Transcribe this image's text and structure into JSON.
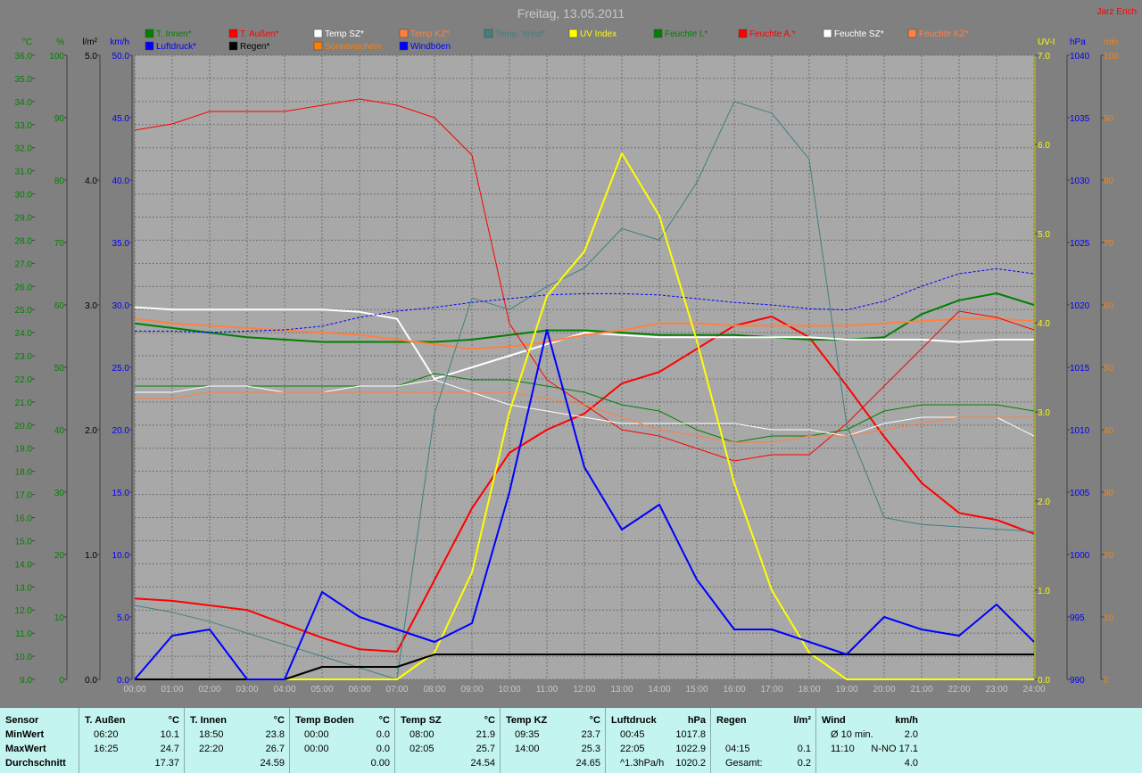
{
  "title": "Freitag, 13.05.2011",
  "author": "Jarz Erich",
  "legend_row1": [
    {
      "label": "T. Innen*",
      "color": "#008000"
    },
    {
      "label": "T. Außen*",
      "color": "#ff0000"
    },
    {
      "label": "Temp SZ*",
      "color": "#ffffff"
    },
    {
      "label": "Temp KZ*",
      "color": "#ff8040"
    },
    {
      "label": "Temp. Wind*",
      "color": "#408080"
    },
    {
      "label": "UV Index",
      "color": "#ffff00"
    },
    {
      "label": "Feuchte I.*",
      "color": "#008000"
    },
    {
      "label": "Feuchte A.*",
      "color": "#ff0000"
    },
    {
      "label": "Feuchte SZ*",
      "color": "#ffffff"
    },
    {
      "label": "Feuchte KZ*",
      "color": "#ff8040"
    }
  ],
  "legend_row2": [
    {
      "label": "Luftdruck*",
      "color": "#0000ff"
    },
    {
      "label": "Regen*",
      "color": "#000000"
    },
    {
      "label": "Sonnenschein",
      "color": "#ff8000"
    },
    {
      "label": "Windböen",
      "color": "#0000ff"
    }
  ],
  "axes": {
    "celsius": {
      "unit": "°C",
      "color": "#008000",
      "min": 9,
      "max": 36,
      "ticks": [
        "36.0",
        "35.0",
        "34.0",
        "33.0",
        "32.0",
        "31.0",
        "30.0",
        "29.0",
        "28.0",
        "27.0",
        "26.0",
        "25.0",
        "24.0",
        "23.0",
        "22.0",
        "21.0",
        "20.0",
        "19.0",
        "18.0",
        "17.0",
        "16.0",
        "15.0",
        "14.0",
        "13.0",
        "12.0",
        "11.0",
        "10.0",
        "9.0"
      ]
    },
    "percent": {
      "unit": "%",
      "color": "#008000",
      "ticks": [
        "100",
        "90",
        "80",
        "70",
        "60",
        "50",
        "40",
        "30",
        "20",
        "10",
        "0"
      ]
    },
    "rain": {
      "unit": "l/m²",
      "color": "#000000",
      "ticks": [
        "5.0",
        "4.0",
        "3.0",
        "2.0",
        "1.0",
        "0.0"
      ]
    },
    "kmh": {
      "unit": "km/h",
      "color": "#0000ff",
      "ticks": [
        "50.0",
        "45.0",
        "40.0",
        "35.0",
        "30.0",
        "25.0",
        "20.0",
        "15.0",
        "10.0",
        "5.0",
        "0.0"
      ]
    },
    "uv": {
      "unit": "UV-I",
      "color": "#ffff00",
      "ticks": [
        "7.0",
        "6.0",
        "5.0",
        "4.0",
        "3.0",
        "2.0",
        "1.0",
        "0.0"
      ]
    },
    "hpa": {
      "unit": "hPa",
      "color": "#0000ff",
      "ticks": [
        "1040",
        "1035",
        "1030",
        "1025",
        "1020",
        "1015",
        "1010",
        "1005",
        "1000",
        "995",
        "990"
      ]
    },
    "min": {
      "unit": "min",
      "color": "#ff8000",
      "ticks": [
        "100",
        "90",
        "80",
        "70",
        "60",
        "50",
        "40",
        "30",
        "20",
        "10",
        "0"
      ]
    }
  },
  "chart_data": {
    "type": "line",
    "title": "Freitag, 13.05.2011",
    "x": [
      "00:00",
      "01:00",
      "02:00",
      "03:00",
      "04:00",
      "05:00",
      "06:00",
      "07:00",
      "08:00",
      "09:00",
      "10:00",
      "11:00",
      "12:00",
      "13:00",
      "14:00",
      "15:00",
      "16:00",
      "17:00",
      "18:00",
      "19:00",
      "20:00",
      "21:00",
      "22:00",
      "23:00",
      "24:00"
    ],
    "grid": true,
    "series": [
      {
        "name": "T. Außen*",
        "axis": "celsius",
        "color": "#ff0000",
        "width": 2,
        "values": [
          12.5,
          12.4,
          12.2,
          12.0,
          11.4,
          10.8,
          10.3,
          10.2,
          13.3,
          16.4,
          18.8,
          19.8,
          20.5,
          21.8,
          22.3,
          23.3,
          24.3,
          24.7,
          23.8,
          21.7,
          19.5,
          17.5,
          16.2,
          15.9,
          15.3
        ]
      },
      {
        "name": "T. Innen*",
        "axis": "celsius",
        "color": "#008000",
        "width": 2,
        "values": [
          24.4,
          24.2,
          24.0,
          23.8,
          23.7,
          23.6,
          23.6,
          23.6,
          23.6,
          23.7,
          23.9,
          24.1,
          24.1,
          24.0,
          23.9,
          23.9,
          23.9,
          23.8,
          23.7,
          23.7,
          23.8,
          24.8,
          25.4,
          25.7,
          25.2
        ]
      },
      {
        "name": "Temp SZ*",
        "axis": "celsius",
        "color": "#ffffff",
        "width": 2,
        "values": [
          25.1,
          25.0,
          25.0,
          25.0,
          25.0,
          25.0,
          24.9,
          24.6,
          22.0,
          22.5,
          23.0,
          23.5,
          24.0,
          23.9,
          23.8,
          23.8,
          23.8,
          23.8,
          23.8,
          23.7,
          23.7,
          23.7,
          23.6,
          23.7,
          23.7
        ]
      },
      {
        "name": "Temp KZ*",
        "axis": "celsius",
        "color": "#ff8040",
        "width": 2,
        "values": [
          24.6,
          24.4,
          24.3,
          24.2,
          24.1,
          24.0,
          23.9,
          23.7,
          23.5,
          23.3,
          23.4,
          23.6,
          23.9,
          24.1,
          24.4,
          24.4,
          24.3,
          24.3,
          24.3,
          24.3,
          24.4,
          24.5,
          24.6,
          24.6,
          24.5
        ]
      },
      {
        "name": "Feuchte I.*",
        "axis": "percent",
        "color": "#008000",
        "width": 1,
        "values": [
          47,
          47,
          47,
          47,
          47,
          47,
          47,
          47,
          49,
          48,
          48,
          47,
          46,
          44,
          43,
          40,
          38,
          39,
          39,
          40,
          43,
          44,
          44,
          44,
          43
        ]
      },
      {
        "name": "Feuchte A.*",
        "axis": "percent",
        "color": "#ff0000",
        "width": 1,
        "values": [
          88,
          89,
          91,
          91,
          91,
          92,
          93,
          92,
          90,
          84,
          57,
          48,
          44,
          40,
          39,
          37,
          35,
          36,
          36,
          41,
          47,
          53,
          59,
          58,
          56
        ]
      },
      {
        "name": "Feuchte SZ*",
        "axis": "percent",
        "color": "#ffffff",
        "width": 1,
        "values": [
          46,
          46,
          47,
          47,
          46,
          46,
          47,
          47,
          48,
          46,
          44,
          43,
          42,
          41,
          41,
          41,
          41,
          40,
          40,
          39,
          41,
          42,
          42,
          42,
          39
        ]
      },
      {
        "name": "Feuchte KZ*",
        "axis": "percent",
        "color": "#ff8040",
        "width": 1,
        "values": [
          45,
          45,
          46,
          46,
          46,
          46,
          46,
          46,
          46,
          46,
          46,
          45,
          44,
          42,
          40,
          39,
          38,
          38,
          39,
          39,
          40,
          41,
          42,
          42,
          42
        ]
      },
      {
        "name": "Temp. Wind*",
        "axis": "celsius",
        "color": "#408080",
        "width": 1,
        "values": [
          12.2,
          11.9,
          11.5,
          11.0,
          10.5,
          10.0,
          9.5,
          9.0,
          20.5,
          25.5,
          25.0,
          26.0,
          26.8,
          28.5,
          28.0,
          30.5,
          34.0,
          33.5,
          31.5,
          20.0,
          16.0,
          15.7,
          15.6,
          15.5,
          15.4
        ]
      },
      {
        "name": "Luftdruck*",
        "axis": "hpa",
        "color": "#0000ff",
        "width": 1,
        "dashed": true,
        "values": [
          1017.9,
          1017.9,
          1017.8,
          1017.9,
          1018.0,
          1018.3,
          1019.0,
          1019.5,
          1019.8,
          1020.2,
          1020.5,
          1020.8,
          1020.9,
          1020.9,
          1020.8,
          1020.5,
          1020.2,
          1020.0,
          1019.7,
          1019.6,
          1020.3,
          1021.5,
          1022.5,
          1022.9,
          1022.5
        ]
      },
      {
        "name": "UV Index",
        "axis": "uv",
        "color": "#ffff00",
        "width": 2,
        "values": [
          0,
          0,
          0,
          0,
          0,
          0,
          0,
          0,
          0.3,
          1.2,
          3.0,
          4.3,
          4.8,
          5.9,
          5.2,
          3.8,
          2.2,
          1.0,
          0.3,
          0,
          0,
          0,
          0,
          0,
          0
        ]
      },
      {
        "name": "Regen*",
        "axis": "rain",
        "color": "#000000",
        "width": 2,
        "values": [
          0,
          0,
          0,
          0,
          0,
          0.1,
          0.1,
          0.1,
          0.2,
          0.2,
          0.2,
          0.2,
          0.2,
          0.2,
          0.2,
          0.2,
          0.2,
          0.2,
          0.2,
          0.2,
          0.2,
          0.2,
          0.2,
          0.2,
          0.2
        ]
      },
      {
        "name": "Windböen",
        "axis": "kmh",
        "color": "#0000ff",
        "width": 2,
        "values": [
          0,
          3.5,
          4.0,
          0,
          0,
          7.0,
          5.0,
          4.0,
          3.0,
          4.5,
          15.0,
          28.0,
          17.0,
          12.0,
          14.0,
          8.0,
          4.0,
          4.0,
          3.0,
          2.0,
          5.0,
          4.0,
          3.5,
          6.0,
          3.0
        ]
      }
    ]
  },
  "stats": {
    "columns": [
      {
        "header": "Sensor",
        "unit": "",
        "rows": [
          {
            "t": "",
            "v": "MinWert"
          },
          {
            "t": "",
            "v": "MaxWert"
          },
          {
            "t": "",
            "v": "Durchschnitt"
          }
        ]
      },
      {
        "header": "T. Außen",
        "unit": "°C",
        "rows": [
          {
            "t": "06:20",
            "v": "10.1"
          },
          {
            "t": "16:25",
            "v": "24.7"
          },
          {
            "t": "",
            "v": "17.37"
          }
        ]
      },
      {
        "header": "T. Innen",
        "unit": "°C",
        "rows": [
          {
            "t": "18:50",
            "v": "23.8"
          },
          {
            "t": "22:20",
            "v": "26.7"
          },
          {
            "t": "",
            "v": "24.59"
          }
        ]
      },
      {
        "header": "Temp Boden",
        "unit": "°C",
        "rows": [
          {
            "t": "00:00",
            "v": "0.0"
          },
          {
            "t": "00:00",
            "v": "0.0"
          },
          {
            "t": "",
            "v": "0.00"
          }
        ]
      },
      {
        "header": "Temp SZ",
        "unit": "°C",
        "rows": [
          {
            "t": "08:00",
            "v": "21.9"
          },
          {
            "t": "02:05",
            "v": "25.7"
          },
          {
            "t": "",
            "v": "24.54"
          }
        ]
      },
      {
        "header": "Temp KZ",
        "unit": "°C",
        "rows": [
          {
            "t": "09:35",
            "v": "23.7"
          },
          {
            "t": "14:00",
            "v": "25.3"
          },
          {
            "t": "",
            "v": "24.65"
          }
        ]
      },
      {
        "header": "Luftdruck",
        "unit": "hPa",
        "rows": [
          {
            "t": "00:45",
            "v": "1017.8"
          },
          {
            "t": "22:05",
            "v": "1022.9"
          },
          {
            "t": "^1.3hPa/h",
            "v": "1020.2"
          }
        ]
      },
      {
        "header": "Regen",
        "unit": "l/m²",
        "rows": [
          {
            "t": "",
            "v": ""
          },
          {
            "t": "04:15",
            "v": "0.1"
          },
          {
            "t": "Gesamt:",
            "v": "0.2"
          }
        ]
      },
      {
        "header": "Wind",
        "unit": "km/h",
        "rows": [
          {
            "t": "Ø 10 min.",
            "v": "2.0"
          },
          {
            "t": "11:10",
            "v": "N-NO 17.1"
          },
          {
            "t": "",
            "v": "4.0"
          }
        ]
      }
    ]
  }
}
